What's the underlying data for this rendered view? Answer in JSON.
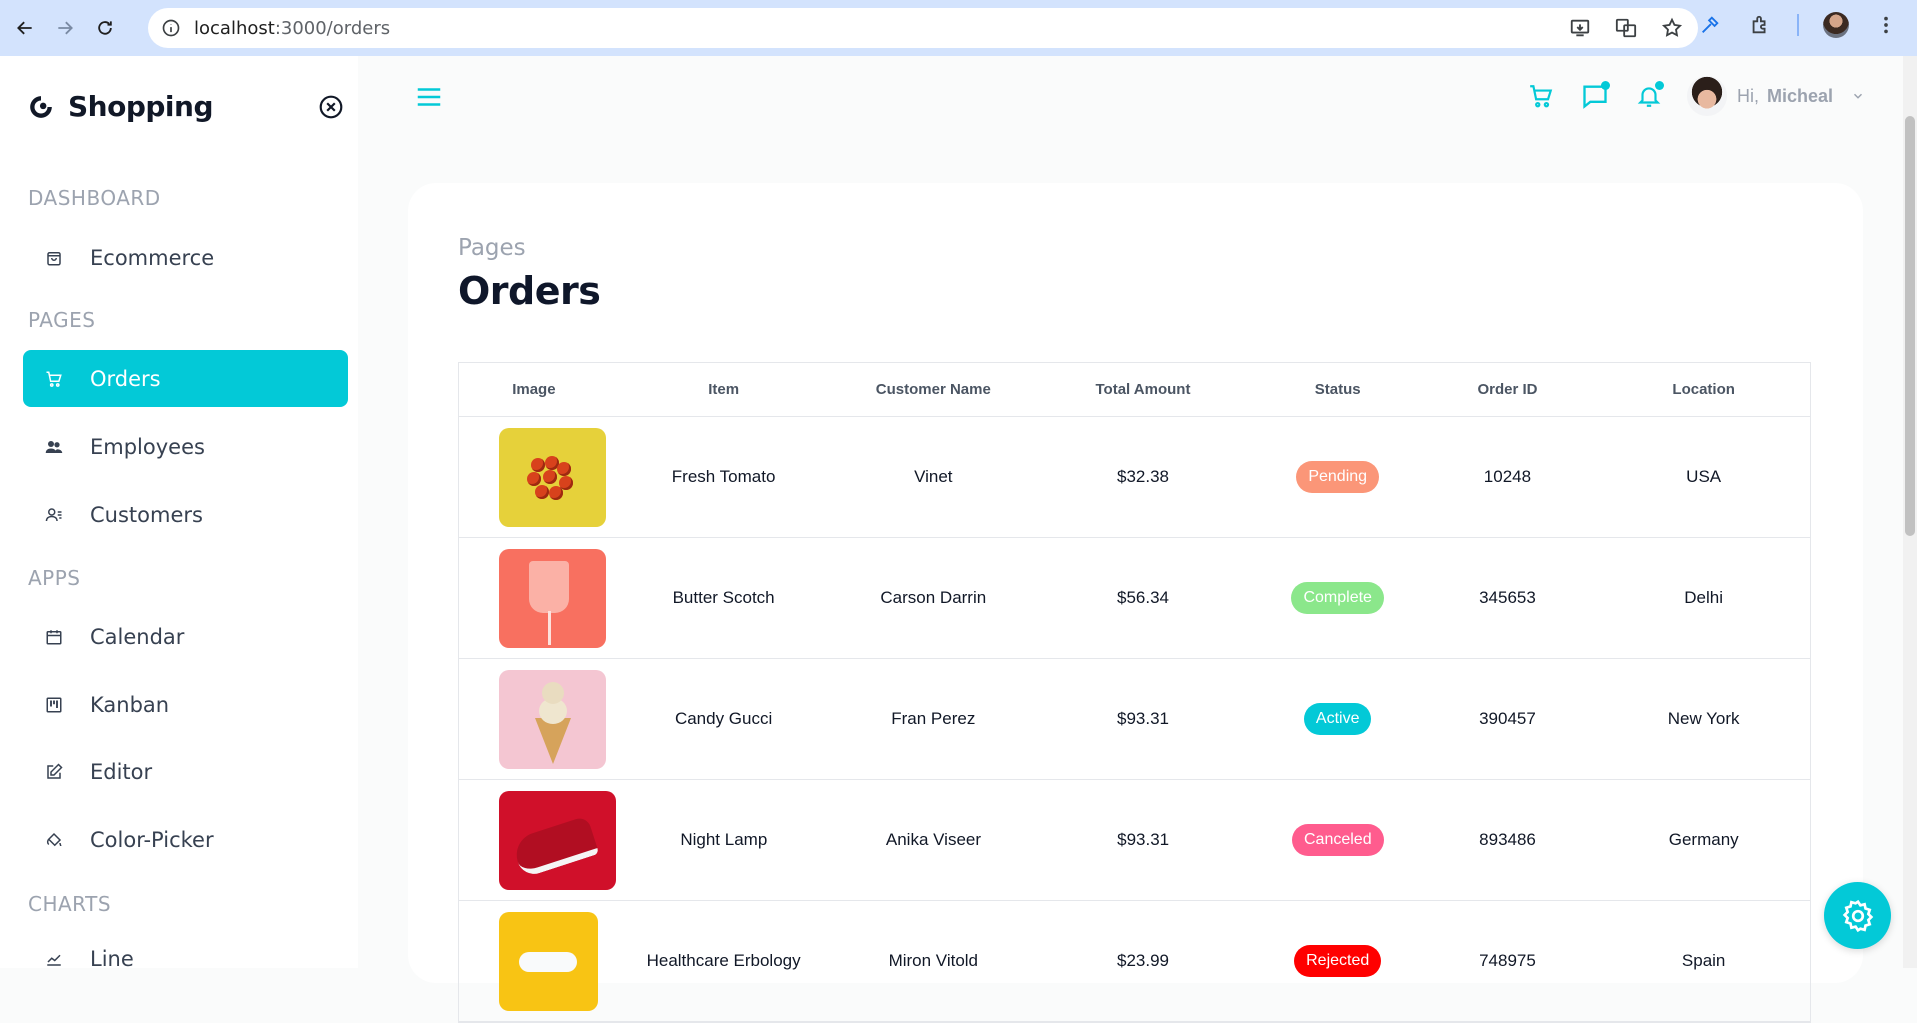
{
  "browser": {
    "url_host": "localhost",
    "url_path": ":3000/orders"
  },
  "sidebar": {
    "brand": "Shopping",
    "sections": [
      {
        "title": "DASHBOARD",
        "items": [
          {
            "label": "Ecommerce",
            "icon": "shopping-bag-icon"
          }
        ]
      },
      {
        "title": "PAGES",
        "items": [
          {
            "label": "Orders",
            "icon": "cart-icon",
            "active": true
          },
          {
            "label": "Employees",
            "icon": "employees-icon"
          },
          {
            "label": "Customers",
            "icon": "customers-icon"
          }
        ]
      },
      {
        "title": "APPS",
        "items": [
          {
            "label": "Calendar",
            "icon": "calendar-icon"
          },
          {
            "label": "Kanban",
            "icon": "kanban-icon"
          },
          {
            "label": "Editor",
            "icon": "edit-icon"
          },
          {
            "label": "Color-Picker",
            "icon": "paint-bucket-icon"
          }
        ]
      },
      {
        "title": "CHARTS",
        "items": [
          {
            "label": "Line",
            "icon": "line-chart-icon"
          }
        ]
      }
    ]
  },
  "topbar": {
    "greeting": "Hi,",
    "user_name": "Micheal"
  },
  "page": {
    "crumb": "Pages",
    "title": "Orders"
  },
  "grid": {
    "columns": [
      "Image",
      "Item",
      "Customer Name",
      "Total Amount",
      "Status",
      "Order ID",
      "Location"
    ],
    "rows": [
      {
        "image": "tomato",
        "item": "Fresh Tomato",
        "customer": "Vinet",
        "amount": "$32.38",
        "status": "Pending",
        "status_color": "#fb9678",
        "order_id": "10248",
        "location": "USA"
      },
      {
        "image": "cup",
        "item": "Butter Scotch",
        "customer": "Carson Darrin",
        "amount": "$56.34",
        "status": "Complete",
        "status_color": "#8be78b",
        "order_id": "345653",
        "location": "Delhi"
      },
      {
        "image": "icecream",
        "item": "Candy Gucci",
        "customer": "Fran Perez",
        "amount": "$93.31",
        "status": "Active",
        "status_color": "#03c9d7",
        "order_id": "390457",
        "location": "New York"
      },
      {
        "image": "shoe",
        "item": "Night Lamp",
        "customer": "Anika Viseer",
        "amount": "$93.31",
        "status": "Canceled",
        "status_color": "#ff5c8e",
        "order_id": "893486",
        "location": "Germany"
      },
      {
        "image": "car",
        "item": "Healthcare Erbology",
        "customer": "Miron Vitold",
        "amount": "$23.99",
        "status": "Rejected",
        "status_color": "#ff0000",
        "order_id": "748975",
        "location": "Spain"
      }
    ]
  },
  "colors": {
    "accent": "#03c9d7"
  }
}
